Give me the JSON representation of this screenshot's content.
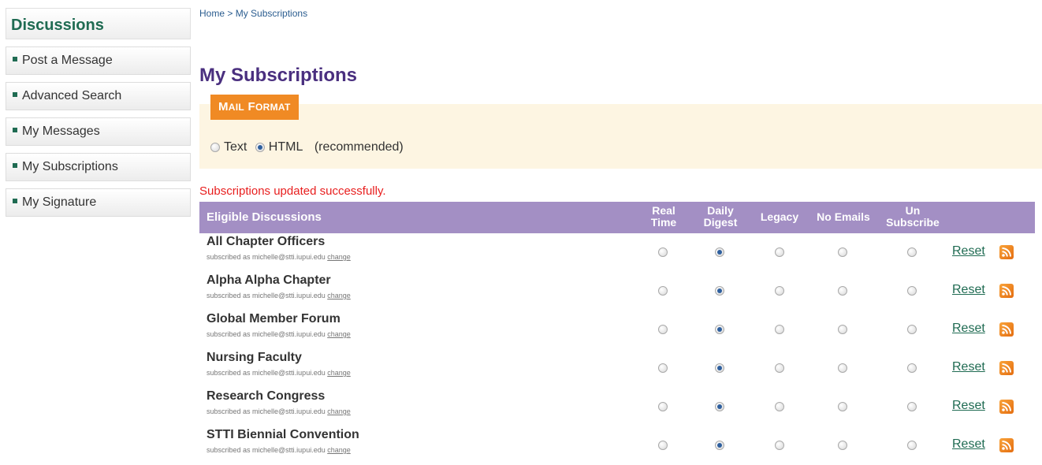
{
  "sidebar": {
    "title": "Discussions",
    "items": [
      {
        "label": "Post a Message"
      },
      {
        "label": "Advanced Search"
      },
      {
        "label": "My Messages"
      },
      {
        "label": "My Subscriptions"
      },
      {
        "label": "My Signature"
      }
    ]
  },
  "breadcrumb": {
    "home": "Home",
    "separator": " > ",
    "current": "My Subscriptions"
  },
  "page": {
    "title": "My Subscriptions",
    "mail_format": {
      "tab_label_first": "M",
      "tab_label_rest": "AIL",
      "tab_label_first2": "F",
      "tab_label_rest2": "ORMAT",
      "options": [
        {
          "label": "Text",
          "selected": false
        },
        {
          "label": "HTML",
          "selected": true
        }
      ],
      "note": "(recommended)"
    },
    "status_message": "Subscriptions updated successfully."
  },
  "table": {
    "headers": {
      "name": "Eligible Discussions",
      "real_time_1": "Real",
      "real_time_2": "Time",
      "daily_digest_1": "Daily",
      "daily_digest_2": "Digest",
      "legacy": "Legacy",
      "no_emails": "No Emails",
      "unsubscribe_1": "Un",
      "unsubscribe_2": "Subscribe"
    },
    "subscribed_prefix": "subscribed as michelle@stti.iupui.edu",
    "change_label": "change",
    "reset_label": "Reset",
    "selected_option": "Daily Digest",
    "rows": [
      {
        "name": "All Chapter Officers"
      },
      {
        "name": "Alpha Alpha Chapter"
      },
      {
        "name": "Global Member Forum"
      },
      {
        "name": "Nursing Faculty"
      },
      {
        "name": "Research Congress"
      },
      {
        "name": "STTI Biennial Convention"
      }
    ]
  },
  "colors": {
    "sidebar_title": "#1f6b52",
    "page_title": "#4a2f7f",
    "table_header": "#a38fc4",
    "mail_tab": "#f08a24",
    "mail_panel": "#fdf5e2",
    "status": "#e81e1e",
    "link": "#1f6b52"
  }
}
